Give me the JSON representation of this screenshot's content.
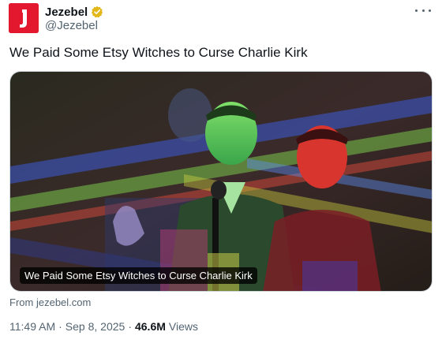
{
  "author": {
    "display_name": "Jezebel",
    "handle": "@Jezebel",
    "logo_letter": "J",
    "brand_color": "#e3172d",
    "verified_color": "#e2b719"
  },
  "tweet": {
    "text": "We Paid Some Etsy Witches to Curse Charlie Kirk"
  },
  "card": {
    "caption": "We Paid Some Etsy Witches to Curse Charlie Kirk",
    "source_prefix": "From",
    "source_domain": "jezebel.com"
  },
  "meta": {
    "time": "11:49 AM",
    "separator": "·",
    "date": "Sep 8, 2025",
    "views_count": "46.6M",
    "views_label": "Views"
  },
  "icons": {
    "more": "more-horizontal-icon",
    "verified": "verified-badge-icon"
  }
}
